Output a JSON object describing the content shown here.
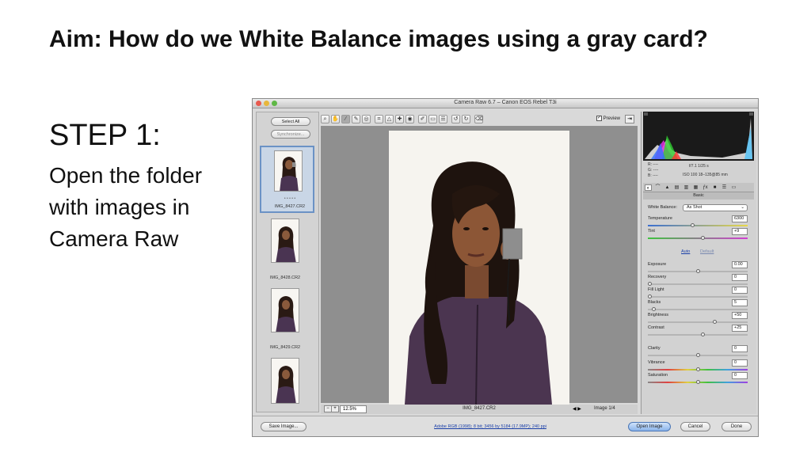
{
  "slide": {
    "title": "Aim: How do we White Balance images using a gray card?",
    "step_heading": "STEP 1:",
    "step_text": "Open the folder with images in Camera Raw"
  },
  "window": {
    "title": "Camera Raw 6.7  –  Canon EOS Rebel T3i",
    "preview_label": "Preview",
    "preview_checked": true
  },
  "filmstrip": {
    "select_all": "Select All",
    "synchronize": "Synchronize...",
    "items": [
      {
        "name": "IMG_8427.CR2",
        "selected": true
      },
      {
        "name": "IMG_8428.CR2",
        "selected": false
      },
      {
        "name": "IMG_8429.CR2",
        "selected": false
      }
    ]
  },
  "status": {
    "zoom": "12.5%",
    "filename": "IMG_8427.CR2",
    "image_count": "Image 1/4"
  },
  "readout": {
    "r": "R:   ----",
    "g": "G:   ----",
    "b": "B:   ----",
    "aperture_shutter": "f/7.1    1/25 s",
    "iso_lens": "ISO 100    18–135@85 mm"
  },
  "basic": {
    "header": "Basic",
    "wb_label": "White Balance:",
    "wb_value": "As Shot",
    "auto": "Auto",
    "default": "Default",
    "sliders": [
      {
        "label": "Temperature",
        "value": "6300",
        "level": 0.45
      },
      {
        "label": "Tint",
        "value": "+9",
        "level": 0.55
      },
      {
        "label": "Exposure",
        "value": "0.00",
        "level": 0.5
      },
      {
        "label": "Recovery",
        "value": "0",
        "level": 0.0
      },
      {
        "label": "Fill Light",
        "value": "0",
        "level": 0.0
      },
      {
        "label": "Blacks",
        "value": "5",
        "level": 0.04
      },
      {
        "label": "Brightness",
        "value": "+50",
        "level": 0.68
      },
      {
        "label": "Contrast",
        "value": "+25",
        "level": 0.55
      },
      {
        "label": "Clarity",
        "value": "0",
        "level": 0.5
      },
      {
        "label": "Vibrance",
        "value": "0",
        "level": 0.5
      },
      {
        "label": "Saturation",
        "value": "0",
        "level": 0.5
      }
    ]
  },
  "bottom": {
    "save_image": "Save Image...",
    "workflow": "Adobe RGB (1998); 8 bit; 3456 by 5184 (17.9MP); 240 ppi",
    "open_image": "Open Image",
    "cancel": "Cancel",
    "done": "Done"
  },
  "colors": {
    "title_text": "#111111",
    "canvas_bg": "#8f8f8f",
    "selection_blue": "#6b92c5",
    "link_blue": "#1a3fa8"
  }
}
